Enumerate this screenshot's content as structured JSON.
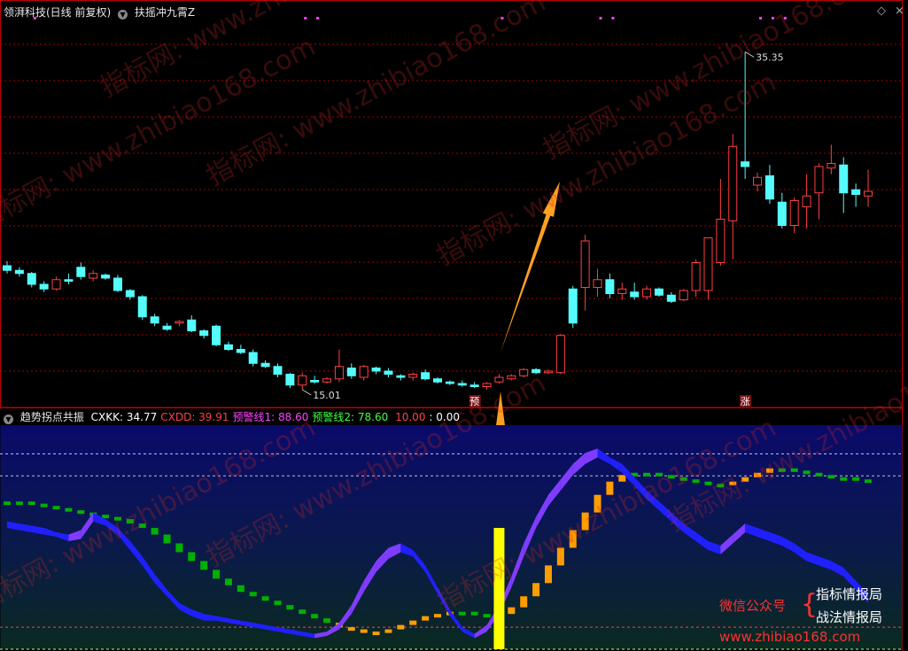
{
  "colors": {
    "bg": "#000000",
    "border": "#c00000",
    "grid": "#a00000",
    "up": "#ff4040",
    "down": "#54fcfc",
    "upper_line": "#7f3cff",
    "lower_line": "#2020ff",
    "stair_up": "#ff9c00",
    "stair_dn": "#00b000",
    "arrow": "#ffa020",
    "signal_bar": "#ffff00",
    "marker": "#ff40ff"
  },
  "main_panel": {
    "title": "领湃科技(日线 前复权)",
    "indicator_name": "扶摇冲九霄Z",
    "high_label": "35.35",
    "low_label": "15.01",
    "signal_labels": [
      "预",
      "涨"
    ],
    "diamond_icon": "diamond-icon"
  },
  "sub_panel": {
    "name": "趋势拐点共振",
    "items": [
      {
        "label": "CXKK:",
        "value": "34.77",
        "color": "#ffffff"
      },
      {
        "label": "CXDD:",
        "value": "39.91",
        "color": "#ff4040"
      },
      {
        "label": "预警线1:",
        "value": "88.60",
        "color": "#ff40ff"
      },
      {
        "label": "预警线2:",
        "value": "78.60",
        "color": "#40ff40"
      },
      {
        "label": "",
        "value": "10.00",
        "color": "#ff4040"
      },
      {
        "label": ":",
        "value": "0.00",
        "color": "#ffffff"
      }
    ]
  },
  "watermark_text": "指标网: www.zhibiao168.com",
  "branding": {
    "wechat_label": "微信公众号",
    "line1": "指标情报局",
    "line2": "战法情报局",
    "url": "www.zhibiao168.com"
  },
  "chart_data": [
    {
      "type": "candlestick",
      "title": "领湃科技(日线 前复权)",
      "ylim": [
        13.5,
        37.5
      ],
      "candles": [
        [
          21.5,
          21.8,
          21.0,
          21.2
        ],
        [
          21.2,
          21.4,
          20.8,
          21.0
        ],
        [
          21.0,
          21.1,
          20.1,
          20.3
        ],
        [
          20.3,
          20.5,
          19.8,
          20.0
        ],
        [
          20.0,
          20.8,
          19.9,
          20.6
        ],
        [
          20.6,
          21.0,
          20.3,
          20.5
        ],
        [
          21.4,
          21.7,
          20.6,
          20.8
        ],
        [
          20.7,
          21.2,
          20.5,
          21.0
        ],
        [
          20.9,
          21.0,
          20.6,
          20.7
        ],
        [
          20.7,
          20.9,
          19.8,
          19.9
        ],
        [
          19.9,
          20.0,
          19.3,
          19.5
        ],
        [
          19.5,
          19.6,
          18.0,
          18.2
        ],
        [
          18.2,
          18.4,
          17.6,
          17.8
        ],
        [
          17.6,
          17.8,
          17.3,
          17.4
        ],
        [
          17.8,
          18.0,
          17.6,
          17.9
        ],
        [
          18.0,
          18.3,
          17.2,
          17.3
        ],
        [
          17.3,
          17.4,
          16.8,
          17.0
        ],
        [
          17.6,
          17.7,
          16.3,
          16.4
        ],
        [
          16.4,
          16.6,
          16.0,
          16.1
        ],
        [
          16.1,
          16.4,
          15.8,
          15.9
        ],
        [
          15.9,
          16.1,
          15.0,
          15.2
        ],
        [
          15.2,
          15.4,
          14.9,
          15.0
        ],
        [
          15.0,
          15.2,
          14.3,
          14.5
        ],
        [
          14.5,
          14.6,
          13.6,
          13.8
        ],
        [
          13.8,
          14.6,
          13.5,
          14.4
        ],
        [
          14.1,
          14.4,
          13.9,
          14.0
        ],
        [
          14.0,
          14.3,
          13.9,
          14.2
        ],
        [
          14.2,
          16.1,
          14.0,
          15.0
        ],
        [
          14.9,
          15.2,
          14.2,
          14.4
        ],
        [
          14.3,
          15.1,
          14.1,
          15.0
        ],
        [
          14.9,
          15.0,
          14.5,
          14.7
        ],
        [
          14.7,
          14.9,
          14.3,
          14.5
        ],
        [
          14.4,
          14.5,
          14.1,
          14.3
        ],
        [
          14.3,
          14.6,
          14.1,
          14.5
        ],
        [
          14.6,
          14.8,
          14.1,
          14.2
        ],
        [
          14.2,
          14.3,
          13.9,
          14.0
        ],
        [
          14.0,
          14.1,
          13.8,
          13.9
        ],
        [
          13.9,
          14.1,
          13.7,
          13.8
        ],
        [
          13.8,
          14.0,
          13.6,
          13.7
        ],
        [
          13.7,
          14.0,
          13.5,
          13.9
        ],
        [
          14.0,
          14.5,
          13.9,
          14.3
        ],
        [
          14.2,
          14.5,
          14.1,
          14.4
        ],
        [
          14.4,
          14.9,
          14.3,
          14.8
        ],
        [
          14.8,
          14.9,
          14.5,
          14.6
        ],
        [
          14.6,
          14.8,
          14.5,
          14.7
        ],
        [
          14.6,
          17.1,
          14.5,
          17.0
        ],
        [
          20.0,
          20.2,
          17.5,
          17.8
        ],
        [
          20.1,
          23.5,
          18.6,
          23.1
        ],
        [
          20.1,
          21.3,
          19.5,
          20.6
        ],
        [
          20.6,
          21.0,
          19.4,
          19.7
        ],
        [
          19.7,
          20.4,
          19.3,
          20.0
        ],
        [
          19.8,
          20.4,
          19.3,
          19.5
        ],
        [
          19.5,
          20.2,
          19.3,
          20.0
        ],
        [
          20.0,
          20.1,
          19.5,
          19.6
        ],
        [
          19.6,
          19.8,
          19.1,
          19.2
        ],
        [
          19.3,
          20.0,
          19.2,
          19.9
        ],
        [
          19.9,
          21.9,
          19.5,
          21.7
        ],
        [
          19.9,
          23.2,
          19.3,
          23.3
        ],
        [
          21.7,
          27.1,
          21.5,
          24.5
        ],
        [
          24.4,
          30.0,
          21.9,
          29.2
        ],
        [
          28.2,
          35.3,
          27.1,
          27.9
        ],
        [
          26.7,
          27.5,
          26.3,
          27.2
        ],
        [
          27.3,
          28.0,
          25.5,
          25.8
        ],
        [
          25.6,
          26.2,
          23.9,
          24.1
        ],
        [
          24.1,
          25.9,
          23.6,
          25.7
        ],
        [
          25.3,
          27.4,
          23.9,
          26.0
        ],
        [
          26.2,
          28.1,
          24.5,
          27.9
        ],
        [
          27.8,
          29.3,
          27.4,
          28.1
        ],
        [
          28.0,
          28.5,
          24.9,
          26.2
        ],
        [
          26.4,
          26.8,
          25.3,
          26.1
        ],
        [
          26.0,
          27.7,
          25.3,
          26.3
        ]
      ]
    },
    {
      "type": "line",
      "title": "趋势拐点共振",
      "ylim": [
        0,
        100
      ],
      "upper_line": [
        58,
        57,
        56,
        55,
        53,
        52,
        54,
        62,
        59,
        55,
        49,
        42,
        34,
        27,
        21,
        18,
        16,
        15,
        14,
        13,
        12,
        11,
        10,
        9,
        8,
        7,
        8,
        12,
        20,
        31,
        40,
        46,
        48,
        45,
        38,
        28,
        18,
        10,
        7,
        11,
        20,
        33,
        48,
        60,
        70,
        77,
        84,
        89,
        91,
        87,
        84,
        78,
        72,
        67,
        62,
        57,
        53,
        49,
        47,
        52,
        57,
        55,
        53,
        51,
        48,
        44,
        42,
        40,
        37,
        31,
        25
      ],
      "lower_line": [
        55,
        54,
        53,
        52,
        51,
        49,
        50,
        58,
        56,
        52,
        45,
        38,
        30,
        24,
        18,
        15,
        13,
        13,
        12,
        11,
        10,
        9,
        8,
        7,
        6,
        5,
        6,
        9,
        16,
        26,
        35,
        41,
        44,
        42,
        35,
        25,
        15,
        8,
        5,
        8,
        16,
        28,
        42,
        55,
        65,
        72,
        79,
        84,
        87,
        84,
        80,
        74,
        68,
        63,
        58,
        53,
        49,
        45,
        43,
        48,
        53,
        51,
        49,
        47,
        44,
        40,
        38,
        36,
        33,
        27,
        21
      ],
      "stair_line": [
        67,
        67,
        66,
        65,
        64,
        63,
        62,
        61,
        60,
        59,
        57,
        55,
        52,
        48,
        44,
        40,
        36,
        32,
        29,
        26,
        24,
        22,
        20,
        18,
        16,
        14,
        12,
        10,
        9,
        8,
        8,
        9,
        11,
        13,
        15,
        16,
        17,
        17,
        16,
        15,
        16,
        19,
        24,
        30,
        38,
        46,
        54,
        62,
        70,
        76,
        79,
        80,
        80,
        79,
        78,
        77,
        76,
        75,
        75,
        76,
        78,
        80,
        82,
        82,
        81,
        80,
        79,
        78,
        78,
        77,
        76
      ],
      "stair_dir": [
        0,
        0,
        0,
        0,
        0,
        0,
        0,
        0,
        0,
        0,
        0,
        0,
        0,
        0,
        0,
        0,
        0,
        0,
        0,
        0,
        0,
        0,
        0,
        0,
        0,
        0,
        0,
        1,
        1,
        1,
        1,
        1,
        1,
        1,
        1,
        1,
        1,
        0,
        0,
        0,
        1,
        1,
        1,
        1,
        1,
        1,
        1,
        1,
        1,
        1,
        1,
        0,
        0,
        0,
        0,
        0,
        0,
        0,
        0,
        1,
        1,
        1,
        1,
        0,
        0,
        0,
        0,
        0,
        0,
        0,
        0
      ],
      "signal_index": 40,
      "level_lines": [
        88.6,
        78.6,
        10.0,
        0.0
      ]
    }
  ]
}
